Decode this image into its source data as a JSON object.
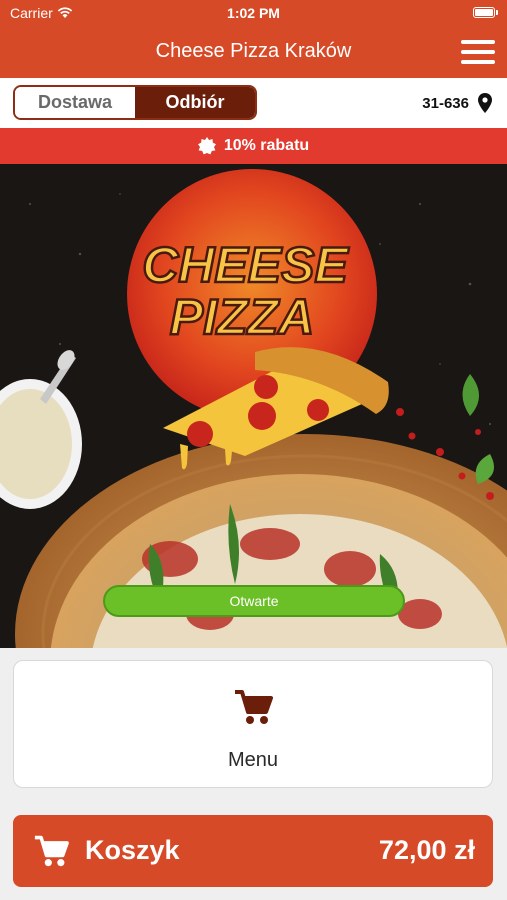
{
  "status_bar": {
    "carrier": "Carrier",
    "time": "1:02 PM"
  },
  "header": {
    "title": "Cheese Pizza Kraków",
    "menu_icon": "hamburger-menu-icon"
  },
  "order_mode": {
    "options": [
      "Dostawa",
      "Odbiór"
    ],
    "selected": "Odbiór",
    "zip_code": "31-636",
    "location_icon": "location-pin-icon"
  },
  "promo": {
    "text": "10% rabatu",
    "icon": "badge-icon"
  },
  "hero": {
    "logo_line1": "CHEESE",
    "logo_line2": "PIZZA",
    "status": "Otwarte"
  },
  "menu_card": {
    "label": "Menu",
    "icon": "cart-icon"
  },
  "cart": {
    "label": "Koszyk",
    "total": "72,00 zł",
    "icon": "cart-icon"
  },
  "colors": {
    "primary": "#d64a27",
    "dark": "#6b1f0b",
    "promo": "#e23a2f",
    "open": "#6bbf27"
  }
}
